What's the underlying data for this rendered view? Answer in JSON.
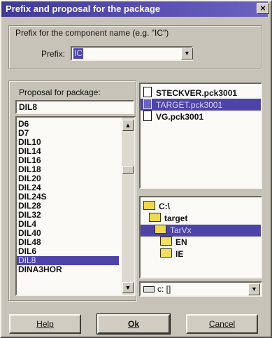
{
  "window": {
    "title": "Prefix and proposal for the package",
    "close_label": "×"
  },
  "prefix_group": {
    "caption": "Prefix for the component name (e.g. \"IC\")",
    "label": "Prefix:",
    "value": "IC"
  },
  "proposal": {
    "caption": "Proposal for package:",
    "input_value": "DIL8",
    "items": [
      "D6",
      "D7",
      "DIL10",
      "DIL14",
      "DIL16",
      "DIL18",
      "DIL20",
      "DIL24",
      "DIL24S",
      "DIL28",
      "DIL32",
      "DIL4",
      "DIL40",
      "DIL48",
      "DIL6",
      "DIL8",
      "DINA3HOR"
    ],
    "selected_index": 15
  },
  "files": {
    "items": [
      "STECKVER.pck3001",
      "TARGET.pck3001",
      "VG.pck3001"
    ],
    "selected_index": 1
  },
  "dirs": {
    "items": [
      {
        "label": "C:\\",
        "depth": 0,
        "open": true
      },
      {
        "label": "target",
        "depth": 1,
        "open": true
      },
      {
        "label": "TarVx",
        "depth": 2,
        "open": true
      },
      {
        "label": "EN",
        "depth": 3,
        "open": false
      },
      {
        "label": "IE",
        "depth": 3,
        "open": false
      }
    ],
    "selected_index": 2
  },
  "drive": {
    "value": "c: []"
  },
  "buttons": {
    "help": "Help",
    "ok": "Ok",
    "cancel": "Cancel"
  }
}
